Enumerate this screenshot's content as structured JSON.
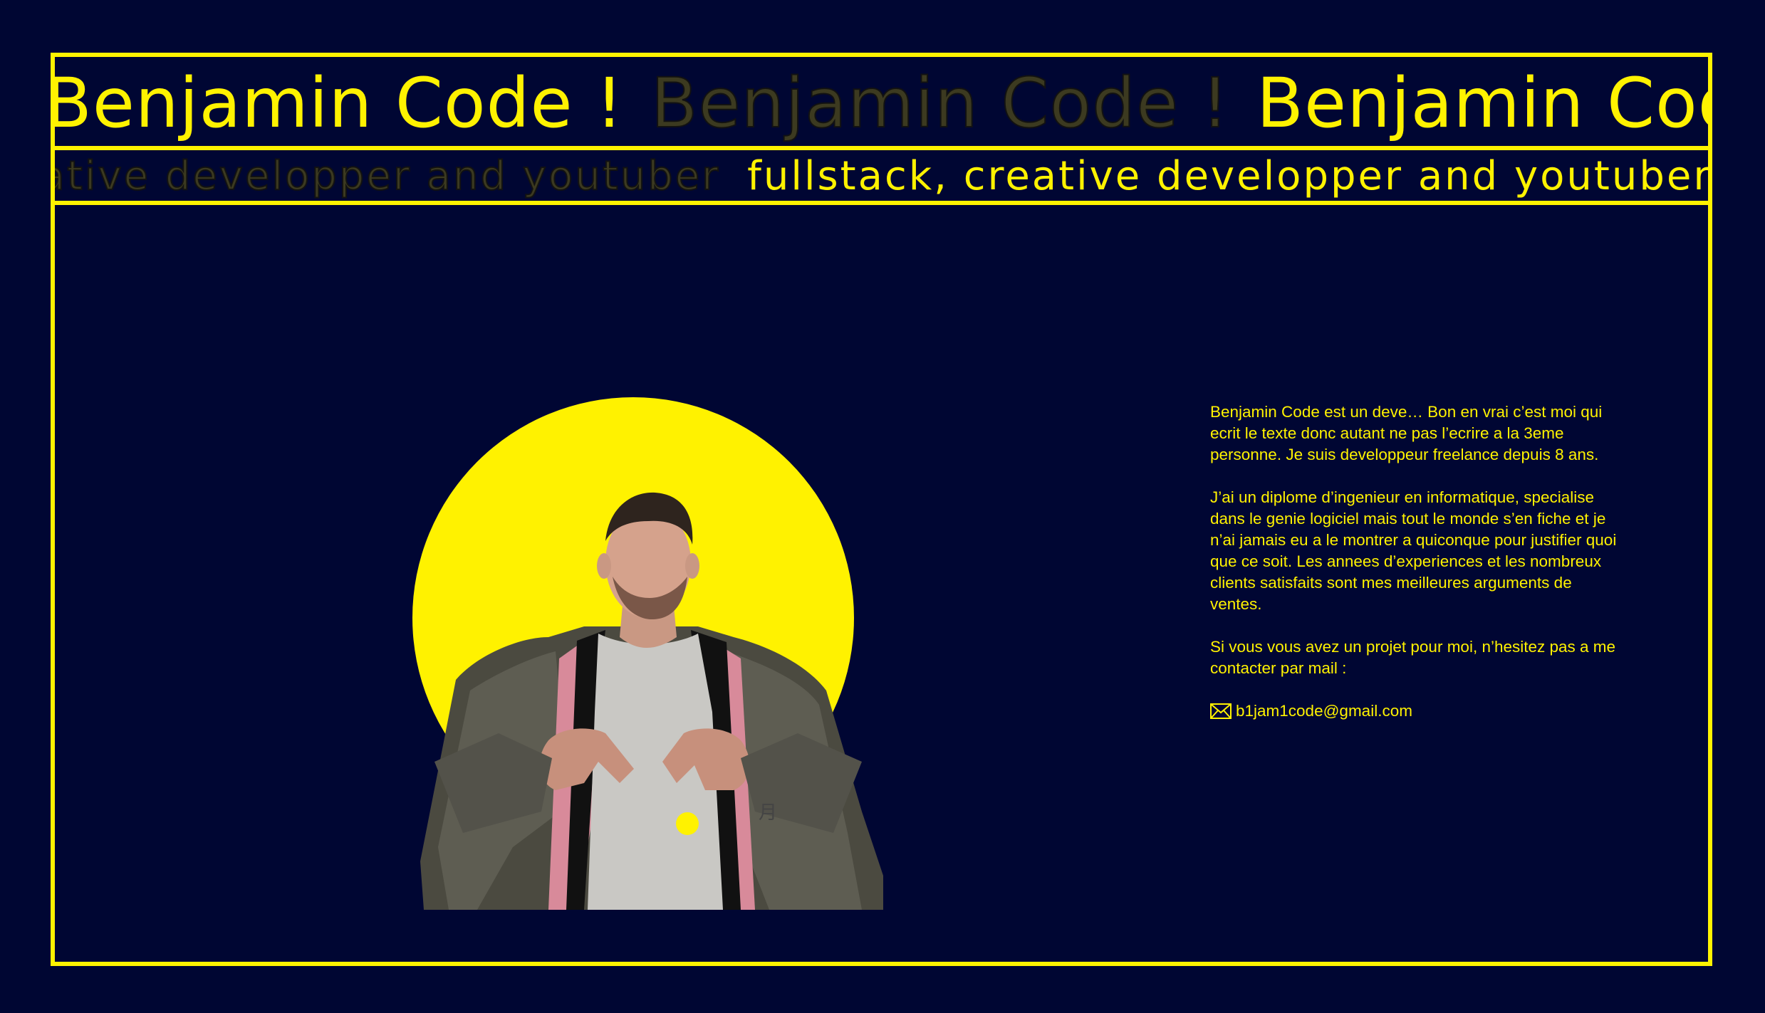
{
  "marquee_title": {
    "items": [
      {
        "text": "Benjamin Code !",
        "style": "solid"
      },
      {
        "text": "Benjamin Code !",
        "style": "outline"
      },
      {
        "text": "Benjamin Code !",
        "style": "solid"
      }
    ]
  },
  "marquee_subtitle": {
    "items": [
      {
        "text": "fullstack, creative developper and youtuber",
        "style": "outline"
      },
      {
        "text": "fullstack, creative developper and youtuber",
        "style": "solid"
      }
    ]
  },
  "bio": {
    "paragraph_1": "Benjamin Code est un deve… Bon en vrai c’est moi qui ecrit le texte donc autant ne pas l’ecrire a la 3eme personne. Je suis developpeur freelance depuis 8 ans.",
    "paragraph_2": "J’ai un diplome d’ingenieur en informatique, specialise dans le genie logiciel mais tout le monde s’en fiche et je n’ai jamais eu a le montrer a quiconque pour justifier quoi que ce soit. Les annees d’experiences et les nombreux clients satisfaits sont mes meilleures arguments de ventes.",
    "paragraph_3": "Si vous vous avez un projet pour moi, n’hesitez pas a me contacter par mail :",
    "email": "b1jam1code@gmail.com",
    "email_icon": "mail-icon"
  },
  "colors": {
    "background": "#000633",
    "accent": "#fff200"
  }
}
